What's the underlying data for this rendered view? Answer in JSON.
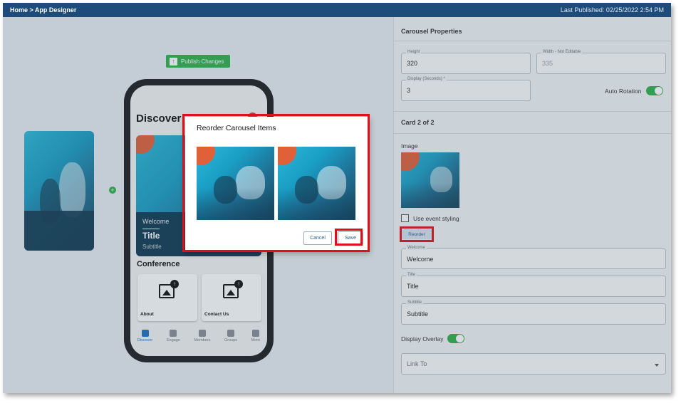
{
  "topbar": {
    "breadcrumb": "Home > App Designer",
    "last_published": "Last Published: 02/25/2022 2:54 PM"
  },
  "canvas": {
    "publish_label": "Publish Changes",
    "phone": {
      "page_title": "Discover",
      "hero": {
        "welcome": "Welcome",
        "title": "Title",
        "subtitle": "Subtitle"
      },
      "section_title": "Conference",
      "tiles": [
        {
          "label": "About"
        },
        {
          "label": "Contact Us"
        }
      ],
      "tabs": [
        {
          "label": "Discover",
          "icon": "discover-icon",
          "active": true
        },
        {
          "label": "Engage",
          "icon": "engage-icon"
        },
        {
          "label": "Members",
          "icon": "members-icon"
        },
        {
          "label": "Groups",
          "icon": "groups-icon"
        },
        {
          "label": "More",
          "icon": "more-icon"
        }
      ]
    }
  },
  "panel": {
    "carousel_header": "Carousel Properties",
    "height": {
      "label": "Height",
      "value": "320"
    },
    "width": {
      "label": "Width - Not Editable",
      "value": "335"
    },
    "display": {
      "label": "Display (Seconds) *",
      "value": "3"
    },
    "auto_rotation": {
      "label": "Auto Rotation",
      "on": true
    },
    "card_header": "Card 2 of 2",
    "image_label": "Image",
    "use_event_styling": {
      "label": "Use event styling",
      "checked": false
    },
    "reorder_label": "Reorder",
    "welcome": {
      "label": "Welcome",
      "value": "Welcome"
    },
    "title": {
      "label": "Title",
      "value": "Title"
    },
    "subtitle": {
      "label": "Subtitle",
      "value": "Subtitle"
    },
    "display_overlay": {
      "label": "Display Overlay",
      "on": true
    },
    "link_to": {
      "placeholder": "Link To"
    }
  },
  "modal": {
    "title": "Reorder Carousel Items",
    "cancel_label": "Cancel",
    "save_label": "Save"
  },
  "colors": {
    "topbar": "#1e4c7a",
    "accent_green": "#2fb14b",
    "highlight_red": "#e0101a"
  }
}
